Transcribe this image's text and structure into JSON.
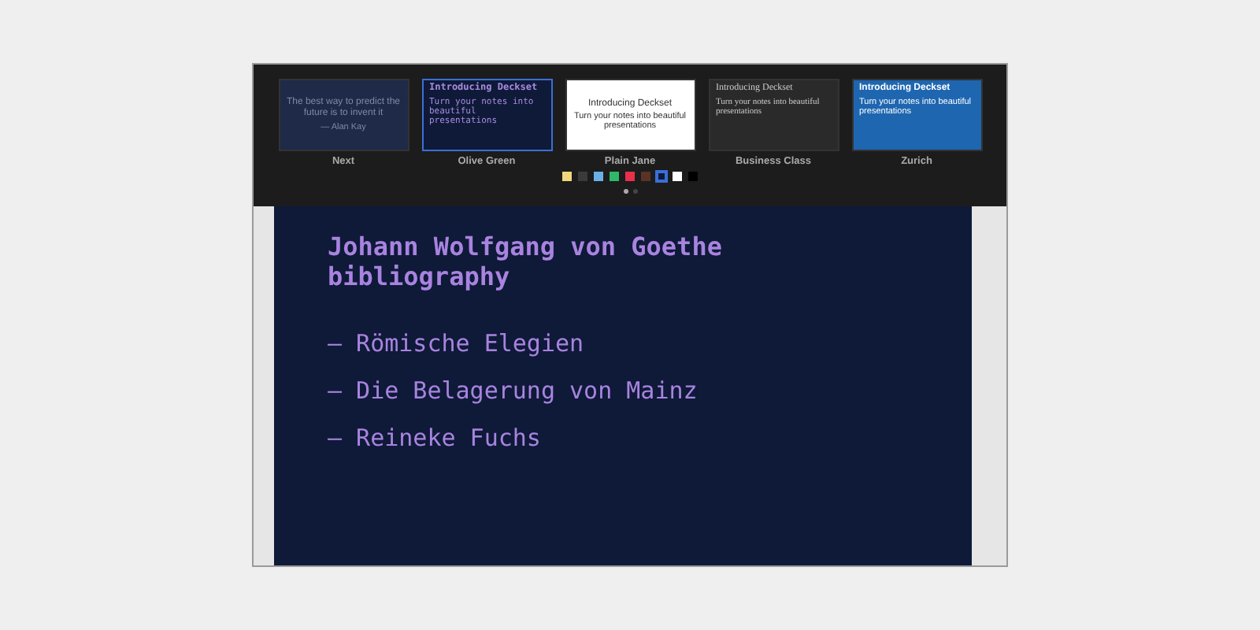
{
  "themes": [
    {
      "name": "Next",
      "kind": "quote",
      "selected": false,
      "title": "The best way to predict the future is to invent it",
      "subtitle": "— Alan Kay"
    },
    {
      "name": "Olive Green",
      "kind": "olive",
      "selected": true,
      "title": "Introducing Deckset",
      "subtitle": "Turn your notes into beautiful presentations"
    },
    {
      "name": "Plain Jane",
      "kind": "plain",
      "selected": false,
      "title": "Introducing Deckset",
      "subtitle": "Turn your notes into beautiful presentations"
    },
    {
      "name": "Business Class",
      "kind": "business",
      "selected": false,
      "title": "Introducing Deckset",
      "subtitle": "Turn your notes into beautiful presentations"
    },
    {
      "name": "Zurich",
      "kind": "zurich",
      "selected": false,
      "title": "Introducing Deckset",
      "subtitle": "Turn your notes into beautiful presentations"
    }
  ],
  "swatches": [
    {
      "color": "#f0d77c",
      "selected": false
    },
    {
      "color": "#3a3a3a",
      "selected": false
    },
    {
      "color": "#6ab0e6",
      "selected": false
    },
    {
      "color": "#2fb86a",
      "selected": false
    },
    {
      "color": "#e8304a",
      "selected": false
    },
    {
      "color": "#5a3326",
      "selected": false
    },
    {
      "color": "#0e1a38",
      "selected": true
    },
    {
      "color": "#ffffff",
      "selected": false
    },
    {
      "color": "#000000",
      "selected": false
    }
  ],
  "pages": [
    {
      "selected": true
    },
    {
      "selected": false
    }
  ],
  "slide": {
    "title": "Johann Wolfgang von Goethe bibliography",
    "bullets": [
      "— Römische Elegien",
      "— Die Belagerung von Mainz",
      "— Reineke Fuchs"
    ]
  }
}
